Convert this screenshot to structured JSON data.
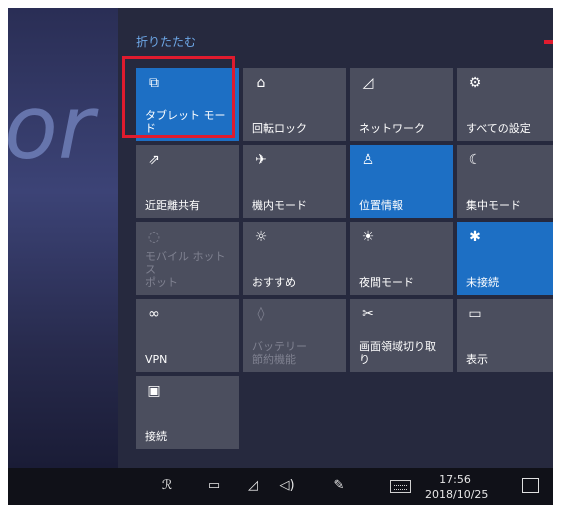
{
  "collapse_label": "折りたたむ",
  "desktop_glyph": "or",
  "colors": {
    "tile_on": "#1d6fc4",
    "tile_off": "#4b4e5e",
    "highlight": "#e01b2e"
  },
  "tiles": [
    {
      "label": "タブレット モード",
      "icon": "tablet-mode-icon",
      "glyph": "⧉",
      "state": "on"
    },
    {
      "label": "回転ロック",
      "icon": "rotation-lock-icon",
      "glyph": "⌂",
      "state": "off"
    },
    {
      "label": "ネットワーク",
      "icon": "network-icon",
      "glyph": "◿",
      "state": "off"
    },
    {
      "label": "すべての設定",
      "icon": "settings-icon",
      "glyph": "⚙",
      "state": "off"
    },
    {
      "label": "近距離共有",
      "icon": "nearby-sharing-icon",
      "glyph": "⇗",
      "state": "off"
    },
    {
      "label": "機内モード",
      "icon": "airplane-mode-icon",
      "glyph": "✈",
      "state": "off"
    },
    {
      "label": "位置情報",
      "icon": "location-icon",
      "glyph": "♙",
      "state": "on"
    },
    {
      "label": "集中モード",
      "icon": "focus-assist-icon",
      "glyph": "☾",
      "state": "off"
    },
    {
      "label": "モバイル ホットス\nポット",
      "icon": "mobile-hotspot-icon",
      "glyph": "◌",
      "state": "disabled"
    },
    {
      "label": "おすすめ",
      "icon": "brightness-icon",
      "glyph": "☼",
      "state": "off"
    },
    {
      "label": "夜間モード",
      "icon": "night-light-icon",
      "glyph": "☀",
      "state": "off"
    },
    {
      "label": "未接続",
      "icon": "bluetooth-icon",
      "glyph": "✱",
      "state": "on"
    },
    {
      "label": "VPN",
      "icon": "vpn-icon",
      "glyph": "∞",
      "state": "off"
    },
    {
      "label": "バッテリー\n節約機能",
      "icon": "battery-saver-icon",
      "glyph": "◊",
      "state": "disabled"
    },
    {
      "label": "画面領域切り取\nり",
      "icon": "screen-snip-icon",
      "glyph": "✂",
      "state": "off"
    },
    {
      "label": "表示",
      "icon": "project-icon",
      "glyph": "▭",
      "state": "off"
    },
    {
      "label": "接続",
      "icon": "connect-icon",
      "glyph": "▣",
      "state": "off"
    }
  ],
  "taskbar": {
    "time": "17:56",
    "date": "2018/10/25",
    "icons": [
      "people-icon",
      "battery-icon",
      "wifi-icon",
      "volume-icon",
      "pen-icon",
      "keyboard-icon",
      "action-center-icon"
    ]
  }
}
